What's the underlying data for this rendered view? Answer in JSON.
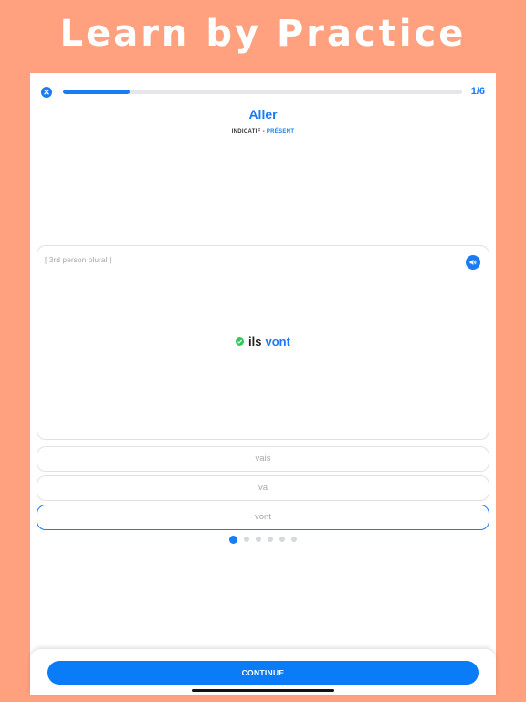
{
  "headline": "Learn by Practice",
  "progress": {
    "fraction": 0.1667,
    "counter": "1/6"
  },
  "verb": {
    "title": "Aller",
    "mood": "INDICATIF",
    "separator": " - ",
    "tense": "PRÉSENT"
  },
  "card": {
    "hint": "[ 3rd person plural ]",
    "pronoun": "ils",
    "conjugation": "vont"
  },
  "options": [
    {
      "label": "vais",
      "selected": false
    },
    {
      "label": "va",
      "selected": false
    },
    {
      "label": "vont",
      "selected": true
    }
  ],
  "pagination": {
    "total": 6,
    "active": 0
  },
  "continue_label": "CONTINUE",
  "colors": {
    "background": "#FFA07F",
    "accent": "#1A7CF5",
    "success": "#34C759"
  },
  "icons": {
    "close": "close-icon",
    "speaker": "speaker-icon",
    "check": "check-circle-icon"
  }
}
